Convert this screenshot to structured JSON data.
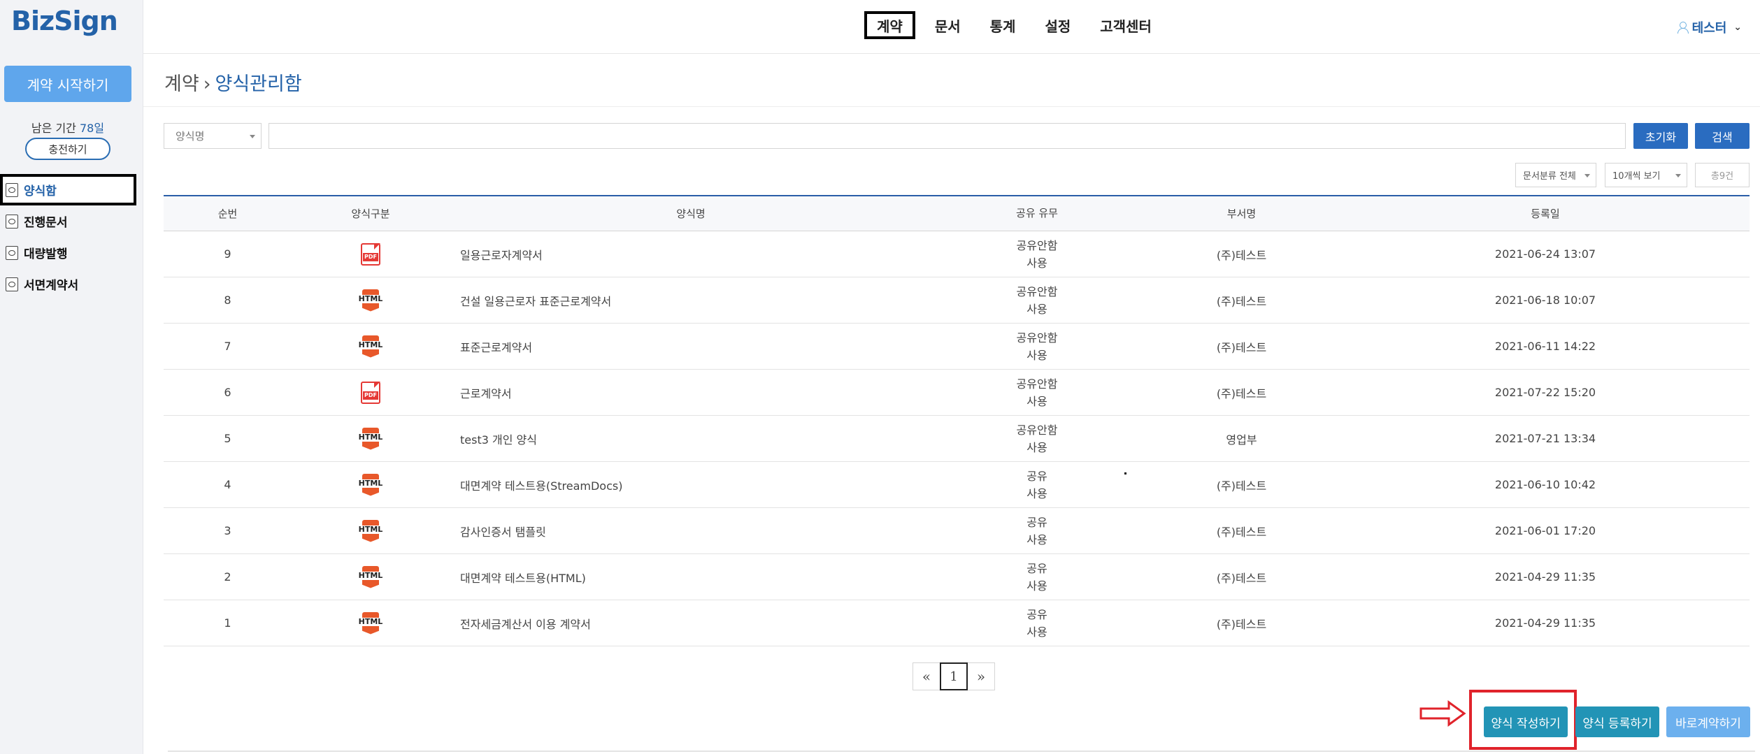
{
  "sidebar": {
    "logo": "BizSign",
    "start_button": "계약 시작하기",
    "remain_label": "남은 기간 ",
    "remain_value": "78일",
    "charge_button": "충전하기",
    "nav": [
      {
        "label": "양식함",
        "icon": "form-box-icon",
        "active": true
      },
      {
        "label": "진행문서",
        "icon": "progress-doc-icon",
        "active": false
      },
      {
        "label": "대량발행",
        "icon": "bulk-issue-icon",
        "active": false
      },
      {
        "label": "서면계약서",
        "icon": "paper-contract-icon",
        "active": false
      }
    ]
  },
  "header": {
    "menu": [
      {
        "label": "계약",
        "active": true
      },
      {
        "label": "문서",
        "active": false
      },
      {
        "label": "통계",
        "active": false
      },
      {
        "label": "설정",
        "active": false
      },
      {
        "label": "고객센터",
        "active": false
      }
    ],
    "user_name": "테스터"
  },
  "breadcrumb": {
    "parent": "계약",
    "separator": "›",
    "current": "양식관리함"
  },
  "search": {
    "select_value": "양식명",
    "input_value": "",
    "reset_button": "초기화",
    "search_button": "검색"
  },
  "filters": {
    "category": "문서분류 전체",
    "page_size": "10개씩 보기",
    "total": "총9건"
  },
  "table": {
    "headers": [
      "순번",
      "양식구분",
      "양식명",
      "공유 유무",
      "부서명",
      "등록일"
    ],
    "rows": [
      {
        "no": "9",
        "type": "PDF",
        "name": "일용근로자계약서",
        "share1": "공유안함",
        "share2": "사용",
        "dept": "(주)테스트",
        "date": "2021-06-24 13:07"
      },
      {
        "no": "8",
        "type": "HTML",
        "name": "건설 일용근로자 표준근로계약서",
        "share1": "공유안함",
        "share2": "사용",
        "dept": "(주)테스트",
        "date": "2021-06-18 10:07"
      },
      {
        "no": "7",
        "type": "HTML",
        "name": "표준근로계약서",
        "share1": "공유안함",
        "share2": "사용",
        "dept": "(주)테스트",
        "date": "2021-06-11 14:22"
      },
      {
        "no": "6",
        "type": "PDF",
        "name": "근로계약서",
        "share1": "공유안함",
        "share2": "사용",
        "dept": "(주)테스트",
        "date": "2021-07-22 15:20"
      },
      {
        "no": "5",
        "type": "HTML",
        "name": "test3 개인 양식",
        "share1": "공유안함",
        "share2": "사용",
        "dept": "영업부",
        "date": "2021-07-21 13:34"
      },
      {
        "no": "4",
        "type": "HTML",
        "name": "대면계약 테스트용(StreamDocs)",
        "share1": "공유",
        "share2": "사용",
        "dept": "(주)테스트",
        "date": "2021-06-10 10:42"
      },
      {
        "no": "3",
        "type": "HTML",
        "name": "감사인증서 탬플릿",
        "share1": "공유",
        "share2": "사용",
        "dept": "(주)테스트",
        "date": "2021-06-01 17:20"
      },
      {
        "no": "2",
        "type": "HTML",
        "name": "대면계약 테스트용(HTML)",
        "share1": "공유",
        "share2": "사용",
        "dept": "(주)테스트",
        "date": "2021-04-29 11:35"
      },
      {
        "no": "1",
        "type": "HTML",
        "name": "전자세금계산서 이용 계약서",
        "share1": "공유",
        "share2": "사용",
        "dept": "(주)테스트",
        "date": "2021-04-29 11:35"
      }
    ]
  },
  "pagination": {
    "prev": "«",
    "current": "1",
    "next": "»"
  },
  "actions": {
    "write_button": "양식 작성하기",
    "register_button": "양식 등록하기",
    "direct_button": "바로계약하기"
  },
  "colors": {
    "brand": "#2462a8",
    "highlight": "#e0232b",
    "action": "#2294b6",
    "start_button": "#5fa6ec"
  }
}
